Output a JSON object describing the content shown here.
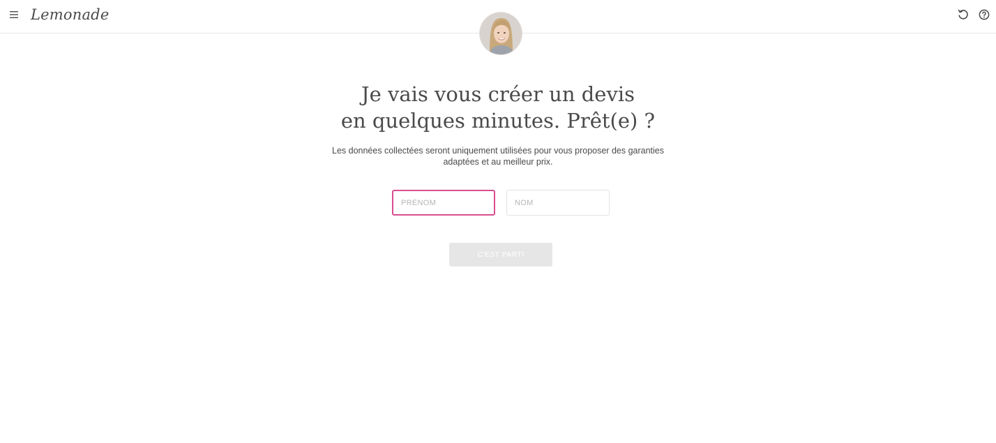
{
  "header": {
    "logo": "Lemonade",
    "menu_icon": "hamburger-menu-icon",
    "reset_icon": "undo-icon",
    "help_icon": "help-circle-icon"
  },
  "main": {
    "title_line1": "Je vais vous créer un devis",
    "title_line2": "en quelques minutes. Prêt(e) ?",
    "subtitle": "Les données collectées seront uniquement utilisées pour vous proposer des garanties adaptées et au meilleur prix.",
    "first_name": {
      "placeholder": "PRÉNOM",
      "value": ""
    },
    "last_name": {
      "placeholder": "NOM",
      "value": ""
    },
    "submit_label": "C'EST PARTI"
  },
  "colors": {
    "accent": "#d94d8f",
    "text": "#4a4a4a",
    "button_disabled": "#e6e6e6",
    "divider": "#e6e6e6"
  }
}
